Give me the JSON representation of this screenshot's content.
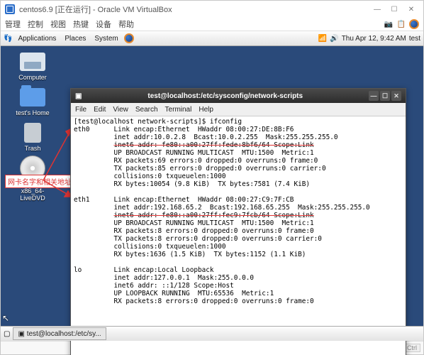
{
  "virtualbox_window": {
    "title": "centos6.9 [正在运行] - Oracle VM VirtualBox",
    "window_controls": {
      "min": "—",
      "max": "☐",
      "close": "✕"
    },
    "menubar": [
      "管理",
      "控制",
      "视图",
      "热键",
      "设备",
      "帮助"
    ]
  },
  "virtualbox_statusbar": {
    "host_key": "Right Ctrl"
  },
  "gnome_panel": {
    "menu": {
      "applications": "Applications",
      "places": "Places",
      "system": "System"
    },
    "clock": "Thu Apr 12,  9:42 AM",
    "user": "test"
  },
  "desktop_icons": {
    "computer": "Computer",
    "home": "test's Home",
    "trash": "Trash",
    "dvd_line1": "CentOS-6.9-x86_64-",
    "dvd_line2": "LiveDVD"
  },
  "taskbar_button": "test@localhost:/etc/sy...",
  "annotation_label": "网卡名字和相关地址",
  "terminal": {
    "title": "test@localhost:/etc/sysconfig/network-scripts",
    "menubar": [
      "File",
      "Edit",
      "View",
      "Search",
      "Terminal",
      "Help"
    ],
    "prompt_left": "[test@localhost network-scripts]",
    "command": "$ ifconfig",
    "eth0": {
      "name": "eth0",
      "line1": "Link encap:Ethernet  HWaddr 08:00:27:DE:8B:F6",
      "line2": "inet addr:10.0.2.8  Bcast:10.0.2.255  Mask:255.255.255.0",
      "line3_strike": "inet6 addr: fe80::a00:27ff:fede:8bf6/64 Scope:Link",
      "line4": "UP BROADCAST RUNNING MULTICAST  MTU:1500  Metric:1",
      "line5": "RX packets:69 errors:0 dropped:0 overruns:0 frame:0",
      "line6": "TX packets:85 errors:0 dropped:0 overruns:0 carrier:0",
      "line7": "collisions:0 txqueuelen:1000",
      "line8": "RX bytes:10054 (9.8 KiB)  TX bytes:7581 (7.4 KiB)"
    },
    "eth1": {
      "name": "eth1",
      "line1": "Link encap:Ethernet  HWaddr 08:00:27:C9:7F:CB",
      "line2": "inet addr:192.168.65.2  Bcast:192.168.65.255  Mask:255.255.255.0",
      "line3_strike": "inet6 addr: fe80::a00:27ff:fec9:7fcb/64 Scope:Link",
      "line4": "UP BROADCAST RUNNING MULTICAST  MTU:1500  Metric:1",
      "line5": "RX packets:8 errors:0 dropped:0 overruns:0 frame:0",
      "line6": "TX packets:8 errors:0 dropped:0 overruns:0 carrier:0",
      "line7": "collisions:0 txqueuelen:1000",
      "line8": "RX bytes:1636 (1.5 KiB)  TX bytes:1152 (1.1 KiB)"
    },
    "lo": {
      "name": "lo",
      "line1": "Link encap:Local Loopback",
      "line2": "inet addr:127.0.0.1  Mask:255.0.0.0",
      "line3": "inet6 addr: ::1/128 Scope:Host",
      "line4": "UP LOOPBACK RUNNING  MTU:65536  Metric:1",
      "line5": "RX packets:8 errors:0 dropped:0 overruns:0 frame:0"
    }
  }
}
